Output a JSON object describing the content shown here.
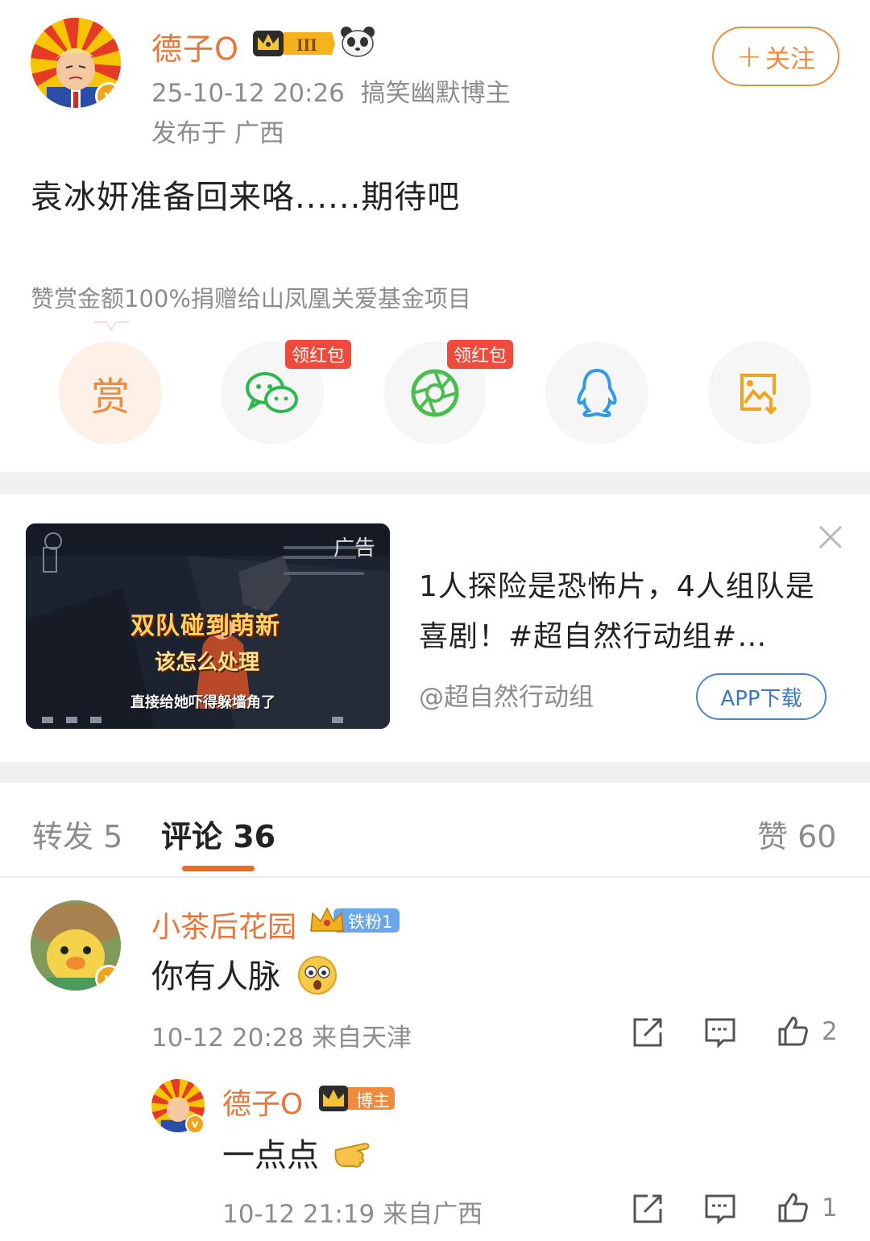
{
  "post": {
    "author": "德子O",
    "timestamp": "25-10-12 20:26",
    "category": "搞笑幽默博主",
    "location": "发布于 广西",
    "follow_label": "关注",
    "follow_plus": "+",
    "content": "袁冰妍准备回来咯......期待吧",
    "donation_note": "赞赏金额100%捐赠给山凤凰关爱基金项目"
  },
  "share": {
    "reward_label": "赏",
    "red_packet_tag": "领红包",
    "items": [
      "reward-icon",
      "wechat-icon",
      "moments-icon",
      "qq-icon",
      "save-image-icon"
    ]
  },
  "ad": {
    "label": "广告",
    "thumb_caption1": "双队碰到萌新",
    "thumb_caption2": "该怎么处理",
    "thumb_caption3": "直接给她吓得躲墙角了",
    "title": "1人探险是恐怖片，4人组队是喜剧！#超自然行动组#…",
    "source": "@超自然行动组",
    "button": "APP下载"
  },
  "tabs": {
    "repost": "转发 5",
    "comments": "评论 36",
    "likes": "赞 60"
  },
  "comments": [
    {
      "name": "小茶后花园",
      "badge": "铁粉1",
      "text": "你有人脉",
      "meta": "10-12 20:28  来自天津",
      "likes": "2"
    }
  ],
  "replies": [
    {
      "name": "德子O",
      "badge": "博主",
      "text": "一点点",
      "meta": "10-12 21:19  来自广西",
      "likes": "1"
    }
  ],
  "colors": {
    "accent": "#f08a3c",
    "name": "#e8763a",
    "muted": "#8c8c8c",
    "link_blue": "#3a78c0"
  }
}
